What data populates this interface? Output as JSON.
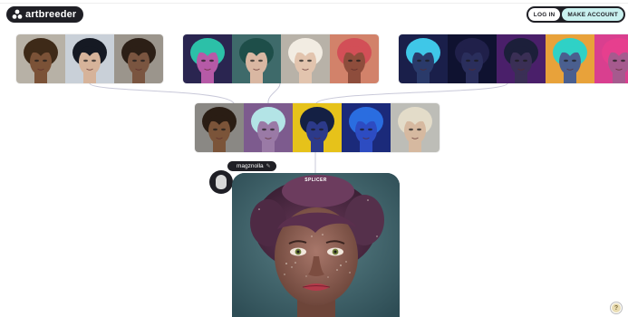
{
  "header": {
    "logo_text": "artbreeder",
    "login_label": "LOG IN",
    "signup_label": "MAKE ACCOUNT"
  },
  "creator": {
    "username": "magznolla",
    "edit_glyph": "✎"
  },
  "main_card": {
    "label": "SPLICER"
  },
  "help": {
    "glyph": "?"
  },
  "colors": {
    "dark": "#1f1f25",
    "signup_accent": "#c9f1ef",
    "connector": "#c9c9d9"
  },
  "icons": [
    "artbreeder-logo-icon",
    "edit-icon",
    "help-icon"
  ],
  "thumbnails": {
    "row1_left": [
      {
        "bg": "#b7b1a6",
        "skin": "#7b5237",
        "hair": "#3e2a18",
        "label": "portrait-curly-brown-hair"
      },
      {
        "bg": "#c9d0d8",
        "skin": "#d6b39a",
        "hair": "#151923",
        "label": "portrait-dark-hair-pale"
      },
      {
        "bg": "#9b958c",
        "skin": "#7a5540",
        "hair": "#2c1f16",
        "label": "portrait-dark-curly"
      }
    ],
    "row1_mid": [
      {
        "bg": "#2a2550",
        "skin": "#b65aa7",
        "hair": "#2cc0a8",
        "label": "portrait-neon-colorful"
      },
      {
        "bg": "#3e6a6a",
        "skin": "#d9b7a2",
        "hair": "#1e4e49",
        "label": "portrait-teal-short-hair"
      },
      {
        "bg": "#b8b2a8",
        "skin": "#e2c4ae",
        "hair": "#f2ece2",
        "label": "portrait-platinum-curls"
      },
      {
        "bg": "#d2826a",
        "skin": "#8e4d3c",
        "hair": "#d24f57",
        "label": "portrait-coral-curls"
      }
    ],
    "row1_right": [
      {
        "bg": "#1a1f4a",
        "skin": "#2a3a6a",
        "hair": "#3fc7e8",
        "label": "portrait-neon-blue"
      },
      {
        "bg": "#0f1230",
        "skin": "#2a2e5c",
        "hair": "#20204a",
        "label": "portrait-dark-navy"
      },
      {
        "bg": "#4a1f6a",
        "skin": "#3a2f55",
        "hair": "#1c1f3a",
        "label": "portrait-neon-purple"
      },
      {
        "bg": "#e8a23a",
        "skin": "#4a5f8f",
        "hair": "#2fd1c6",
        "label": "portrait-neon-turquoise"
      },
      {
        "bg": "#d93f8f",
        "skin": "#a65a8e",
        "hair": "#e63f8e",
        "label": "portrait-neon-pink"
      }
    ],
    "row2": [
      {
        "bg": "#8a8884",
        "skin": "#7b5439",
        "hair": "#2a1d14",
        "label": "portrait-parent-brown"
      },
      {
        "bg": "#7d5b8e",
        "skin": "#9a7aa6",
        "hair": "#b3e4e6",
        "label": "portrait-parent-pastel"
      },
      {
        "bg": "#e6c21a",
        "skin": "#2c3a8a",
        "hair": "#142044",
        "label": "portrait-parent-neon-yellow"
      },
      {
        "bg": "#1b2a7a",
        "skin": "#2d4cc2",
        "hair": "#2a6de0",
        "label": "portrait-parent-blue"
      },
      {
        "bg": "#bdbdb7",
        "skin": "#d6b9a0",
        "hair": "#e3dcc9",
        "label": "portrait-parent-blonde"
      }
    ]
  }
}
